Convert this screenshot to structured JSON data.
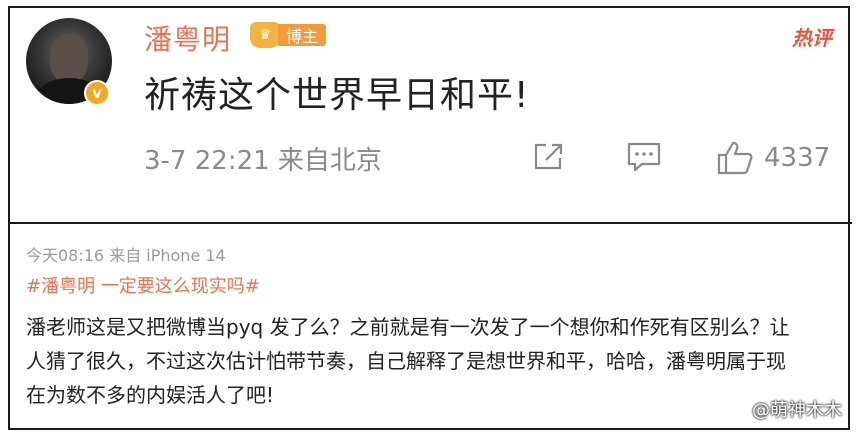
{
  "post": {
    "username": "潘粤明",
    "badge_label": "博主",
    "hot_label": "热评",
    "text": "祈祷这个世界早日和平!",
    "meta": "3-7 22:21 来自北京",
    "like_count": "4337"
  },
  "comment": {
    "meta": "今天08:16 来自 iPhone 14",
    "hashtag": "#潘粤明 一定要这么现实吗#",
    "lines": [
      "潘老师这是又把微博当pyq 发了么？之前就是有一次发了一个想你和作死有区别么？让",
      "人猜了很久，不过这次估计怕带节奏，自己解释了是想世界和平，哈哈，潘粤明属于现",
      "在为数不多的内娱活人了吧!"
    ]
  },
  "watermark": "@萌神木木",
  "colors": {
    "accent": "#eb7350",
    "hot": "#e8553e",
    "gray": "#8a8a8a",
    "badge": "#f39a3a"
  },
  "icons": [
    "share-icon",
    "comment-icon",
    "like-icon",
    "verified-icon",
    "crown-icon"
  ]
}
